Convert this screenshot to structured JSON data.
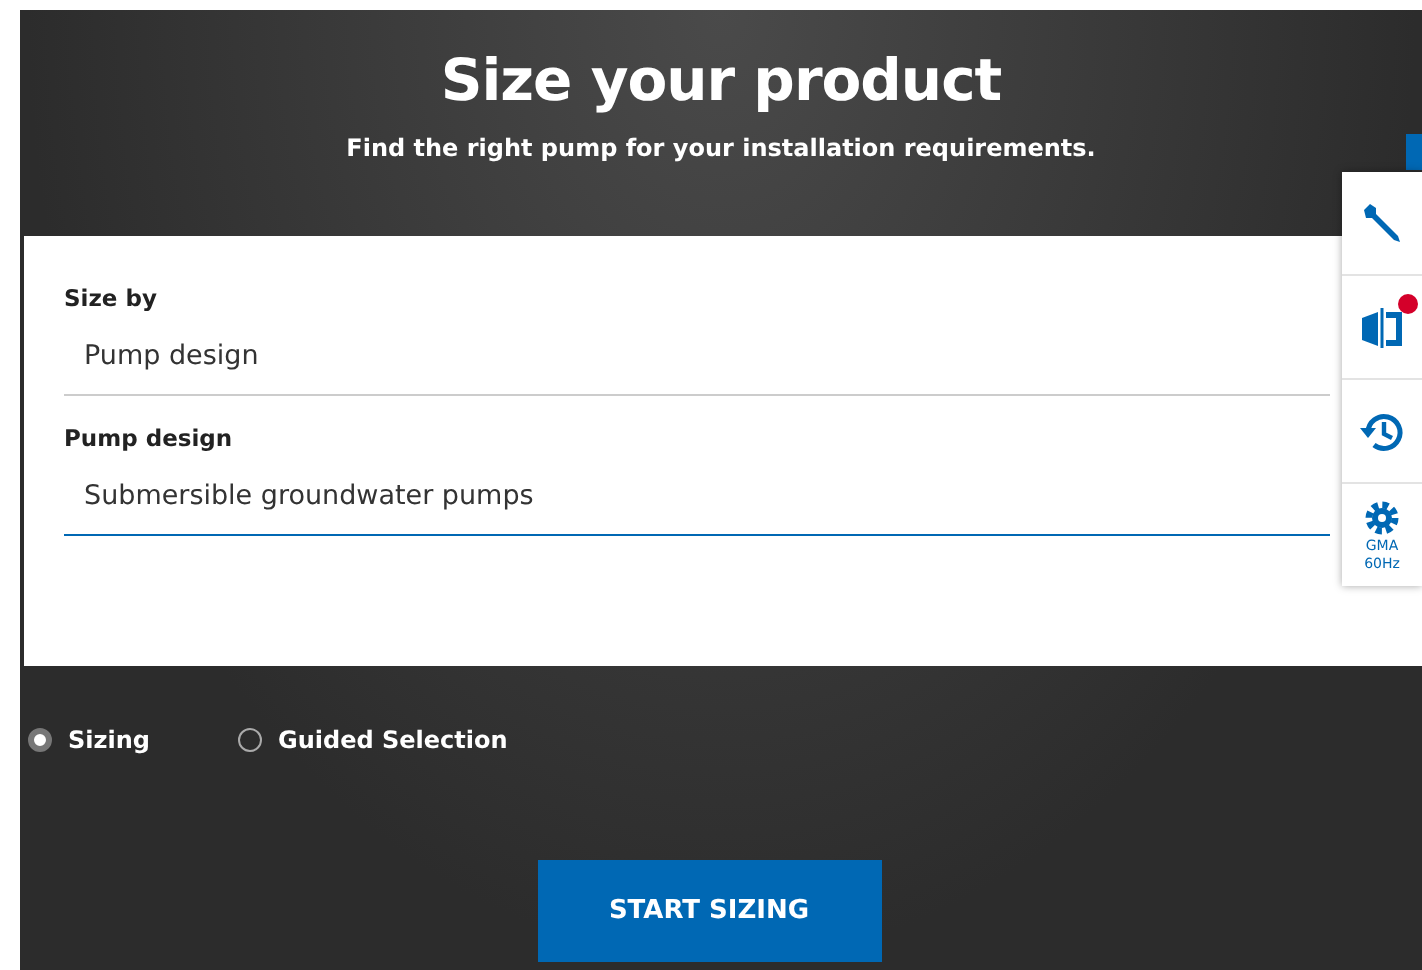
{
  "header": {
    "title": "Size your product",
    "subtitle": "Find the right pump for your installation requirements."
  },
  "fields": [
    {
      "label": "Size by",
      "value": "Pump design",
      "focused": false
    },
    {
      "label": "Pump design",
      "value": "Submersible groundwater pumps",
      "focused": true
    }
  ],
  "modes": [
    {
      "label": "Sizing",
      "selected": true
    },
    {
      "label": "Guided Selection",
      "selected": false
    }
  ],
  "start_button": "START SIZING",
  "toolbar": [
    {
      "kind": "wrench"
    },
    {
      "kind": "compare",
      "badge": true
    },
    {
      "kind": "history"
    },
    {
      "kind": "settings",
      "label_lines": [
        "GMA",
        "60Hz"
      ]
    }
  ]
}
